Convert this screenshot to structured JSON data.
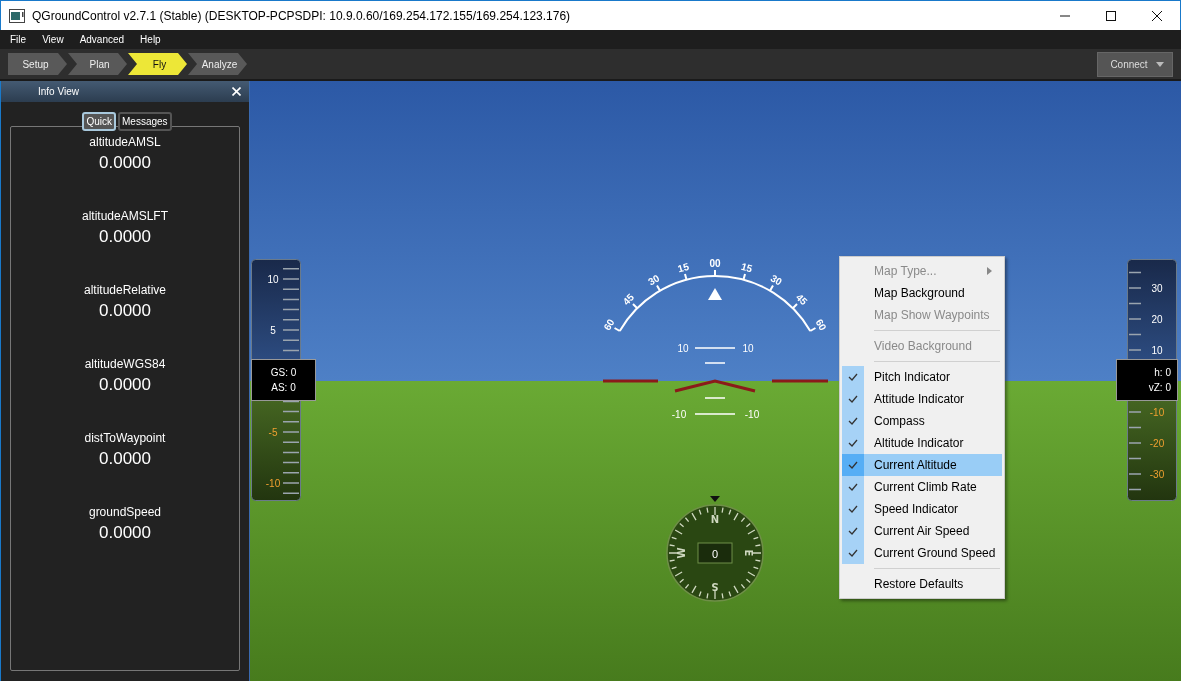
{
  "window": {
    "title": "QGroundControl v2.7.1 (Stable) (DESKTOP-PCPSDPI: 10.9.0.60/169.254.172.155/169.254.123.176)"
  },
  "menu_bar": [
    "File",
    "View",
    "Advanced",
    "Help"
  ],
  "toolbar": {
    "tabs": [
      {
        "label": "Setup",
        "selected": false
      },
      {
        "label": "Plan",
        "selected": false
      },
      {
        "label": "Fly",
        "selected": true
      },
      {
        "label": "Analyze",
        "selected": false
      }
    ],
    "connect_button": "Connect"
  },
  "info_view": {
    "title": "Info View",
    "tabs": [
      {
        "label": "Quick",
        "selected": true
      },
      {
        "label": "Messages",
        "selected": false
      }
    ],
    "values": [
      {
        "name": "altitudeAMSL",
        "value": "0.0000"
      },
      {
        "name": "altitudeAMSLFT",
        "value": "0.0000"
      },
      {
        "name": "altitudeRelative",
        "value": "0.0000"
      },
      {
        "name": "altitudeWGS84",
        "value": "0.0000"
      },
      {
        "name": "distToWaypoint",
        "value": "0.0000"
      },
      {
        "name": "groundSpeed",
        "value": "0.0000"
      }
    ]
  },
  "speed_tape": {
    "above": [
      "10",
      "5"
    ],
    "below": [
      "-5",
      "-10"
    ],
    "readout": [
      "GS: 0",
      "AS: 0"
    ]
  },
  "altitude_tape": {
    "above": [
      "30",
      "20",
      "10"
    ],
    "below": [
      "-10",
      "-20",
      "-30"
    ],
    "readout": [
      "h: 0",
      "vZ: 0"
    ]
  },
  "roll_scale": [
    "60",
    "45",
    "30",
    "15",
    "00",
    "15",
    "30",
    "45",
    "60"
  ],
  "pitch_ladder": {
    "upper": [
      "10",
      "10"
    ],
    "lower": [
      "-10",
      "-10"
    ]
  },
  "compass": {
    "heading": "0",
    "cardinals": [
      "N",
      "E",
      "S",
      "W"
    ]
  },
  "context_menu": {
    "items": [
      {
        "kind": "submenu",
        "label": "Map Type...",
        "disabled": true,
        "selected": false
      },
      {
        "kind": "item",
        "label": "Map Background",
        "disabled": false,
        "selected": false
      },
      {
        "kind": "item",
        "label": "Map Show Waypoints",
        "disabled": true,
        "selected": false
      },
      {
        "kind": "separator"
      },
      {
        "kind": "item",
        "label": "Video Background",
        "disabled": true,
        "selected": false
      },
      {
        "kind": "separator"
      },
      {
        "kind": "check",
        "label": "Pitch Indicator",
        "checked": true,
        "disabled": false,
        "selected": false
      },
      {
        "kind": "check",
        "label": "Attitude Indicator",
        "checked": true,
        "disabled": false,
        "selected": false
      },
      {
        "kind": "check",
        "label": "Compass",
        "checked": true,
        "disabled": false,
        "selected": false
      },
      {
        "kind": "check",
        "label": "Altitude Indicator",
        "checked": true,
        "disabled": false,
        "selected": false
      },
      {
        "kind": "check",
        "label": "Current Altitude",
        "checked": true,
        "disabled": false,
        "selected": true
      },
      {
        "kind": "check",
        "label": "Current Climb Rate",
        "checked": true,
        "disabled": false,
        "selected": false
      },
      {
        "kind": "check",
        "label": "Speed Indicator",
        "checked": true,
        "disabled": false,
        "selected": false
      },
      {
        "kind": "check",
        "label": "Current Air Speed",
        "checked": true,
        "disabled": false,
        "selected": false
      },
      {
        "kind": "check",
        "label": "Current Ground Speed",
        "checked": true,
        "disabled": false,
        "selected": false
      },
      {
        "kind": "separator"
      },
      {
        "kind": "item",
        "label": "Restore Defaults",
        "disabled": false,
        "selected": false
      }
    ]
  }
}
